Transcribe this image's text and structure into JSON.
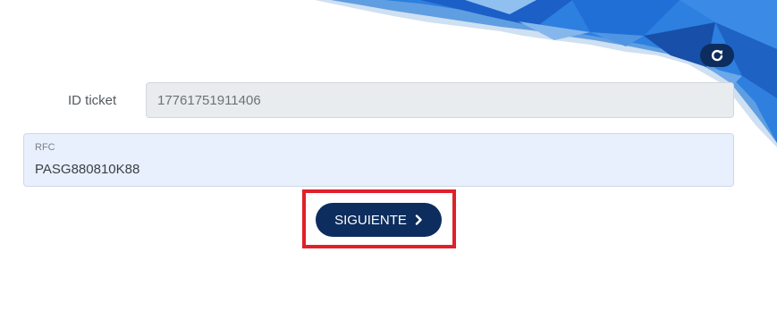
{
  "form": {
    "id_ticket_label": "ID ticket",
    "id_ticket_value": "17761751911406",
    "rfc_label": "RFC",
    "rfc_value": "PASG880810K88"
  },
  "actions": {
    "next_label": "SIGUIENTE"
  },
  "icons": {
    "reset": "refresh-icon",
    "next": "chevron-right-icon"
  },
  "colors": {
    "primary": "#0c2d5e",
    "highlight": "#e0202b",
    "decor_blue": "#1e6fd6",
    "input_disabled_bg": "#e9ecef",
    "input_autofill_bg": "#e8f0fe"
  }
}
